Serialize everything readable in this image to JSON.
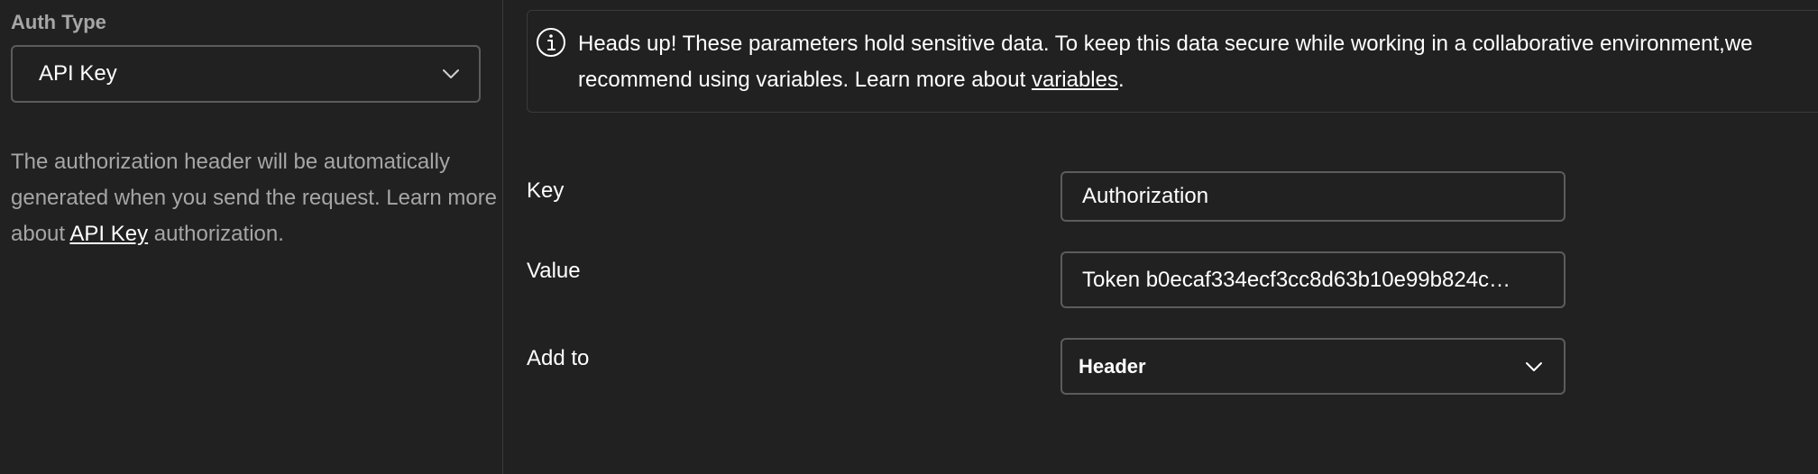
{
  "left_panel": {
    "auth_type_label": "Auth Type",
    "auth_type_value": "API Key",
    "help_text_prefix": "The authorization header will be automatically generated when you send the request. Learn more about ",
    "help_link": "API Key",
    "help_text_suffix": " authorization."
  },
  "alert": {
    "icon": "info-circle-icon",
    "text_prefix": "Heads up! These parameters hold sensitive data. To keep this data secure while working in a collaborative environment,we recommend using variables. Learn more about ",
    "link": "variables",
    "text_suffix": "."
  },
  "fields": {
    "key_label": "Key",
    "key_value": "Authorization",
    "value_label": "Value",
    "value_value": "Token b0ecaf334ecf3cc8d63b10e99b824c…",
    "add_to_label": "Add to",
    "add_to_value": "Header"
  },
  "colors": {
    "background": "#212121",
    "border": "#5c5c5c",
    "muted_text": "#a6a6a6",
    "text": "#ffffff"
  }
}
